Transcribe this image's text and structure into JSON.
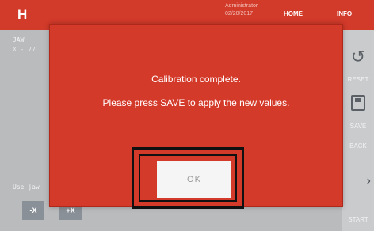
{
  "header": {
    "logo": "H",
    "user": "Administrator",
    "date": "02/20/2017",
    "nav": {
      "home": "HOME",
      "info": "INFO"
    }
  },
  "background": {
    "field_label": "JAW",
    "coord_text": "X - 77",
    "hint_text": "Use jaw",
    "jog_buttons": [
      "-X",
      "+X"
    ]
  },
  "sidebar": {
    "reset_label": "RESET",
    "save_label": "SAVE",
    "back_label": "BACK",
    "start_label": "START"
  },
  "dialog": {
    "line1": "Calibration complete.",
    "line2": "Please press SAVE to apply the new values.",
    "ok_label": "OK"
  },
  "colors": {
    "accent": "#d43a2a",
    "background": "#b9bbbd",
    "button": "#f5f5f5"
  }
}
